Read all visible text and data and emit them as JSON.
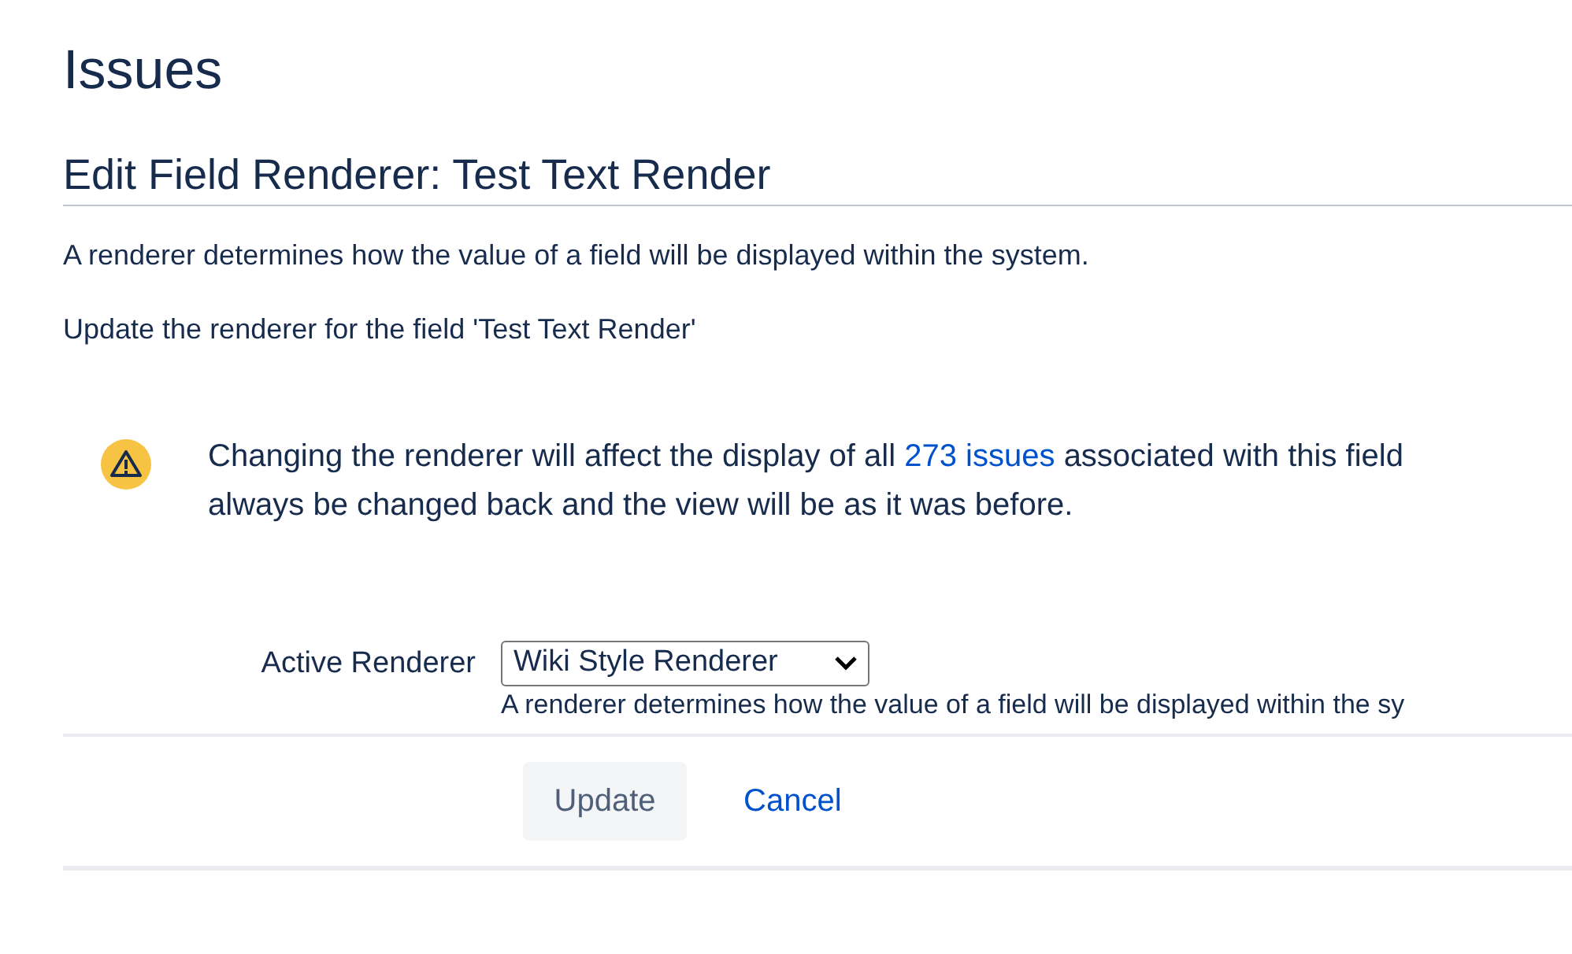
{
  "page_title": "Issues",
  "section_title": "Edit Field Renderer: Test Text Render",
  "description": "A renderer determines how the value of a field will be displayed within the system.",
  "instruction": "Update the renderer for the field 'Test Text Render'",
  "warning": {
    "before": "Changing the renderer will affect the display of all",
    "link": "273 issues",
    "after": "associated with this field",
    "line_2": "always be changed back and the view will be as it was before."
  },
  "form": {
    "label": "Active Renderer",
    "value": "Wiki Style Renderer",
    "help": "A renderer determines how the value of a field will be displayed within the sy"
  },
  "buttons": {
    "update": {
      "label": "Update",
      "disabled": true
    },
    "cancel": "Cancel"
  }
}
